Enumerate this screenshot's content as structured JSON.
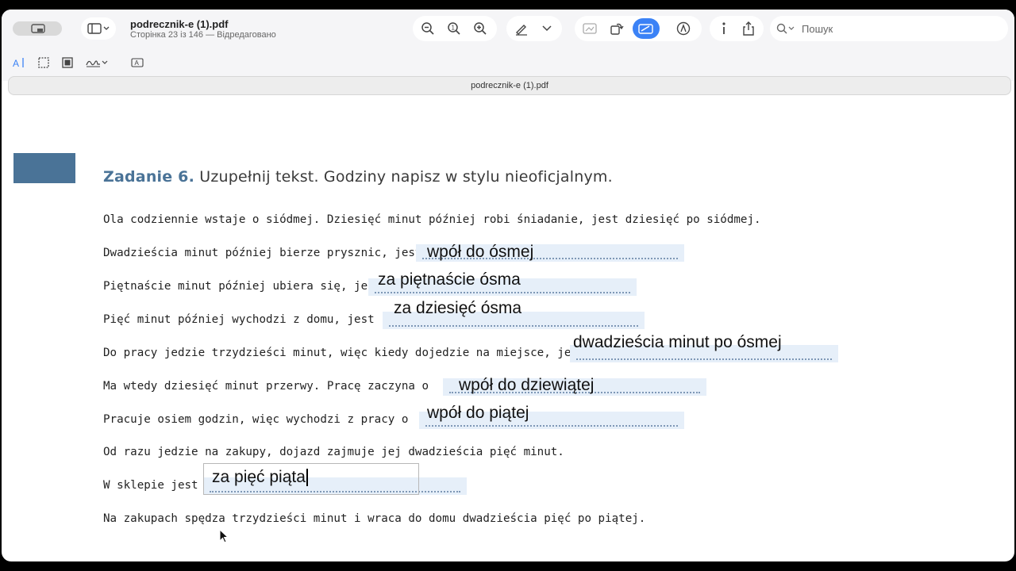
{
  "window": {
    "title": "podrecznik-e (1).pdf",
    "subtitle": "Сторінка 23 із 146 — Відредаговано",
    "tab_title": "podrecznik-e (1).pdf"
  },
  "search": {
    "placeholder": "Пошук"
  },
  "icons": {
    "sidebar": "sidebar-icon",
    "zoom_out": "zoom-out-icon",
    "zoom_fit": "zoom-fit-icon",
    "zoom_in": "zoom-in-icon",
    "highlight": "highlighter-icon",
    "markup": "markup-icon",
    "rotate": "rotate-icon",
    "info": "info-icon",
    "share": "share-icon"
  },
  "colors": {
    "accent": "#4a7397",
    "field_bg": "#e6eff9",
    "toolbar_active": "#3b82f6"
  },
  "exercise": {
    "lead": "Zadanie 6.",
    "instruction": "Uzupełnij tekst. Godziny napisz w stylu nieoficjalnym.",
    "lines": [
      "Ola codziennie wstaje o siódmej. Dziesięć minut później robi śniadanie, jest dziesięć po siódmej.",
      "Dwadzieścia minut później bierze prysznic, jest",
      "Piętnaście minut później ubiera się, jest",
      "Pięć minut później wychodzi z domu, jest",
      "Do pracy jedzie trzydzieści minut, więc kiedy dojedzie na miejsce, jest",
      "Ma wtedy dziesięć minut przerwy. Pracę zaczyna o",
      "Pracuje osiem godzin, więc wychodzi z pracy o",
      "Od razu jedzie na zakupy, dojazd zajmuje jej dwadzieścia pięć minut.",
      "W sklepie jest",
      "Na zakupach spędza trzydzieści minut i wraca do domu dwadzieścia pięć po piątej."
    ],
    "answers": [
      "wpół do ósmej",
      "za piętnaście ósma",
      "za dziesięć ósma",
      "dwadzieścia minut po ósmej",
      "wpół do dziewiątej",
      "wpół do piątej",
      "za pięć piąta"
    ]
  }
}
